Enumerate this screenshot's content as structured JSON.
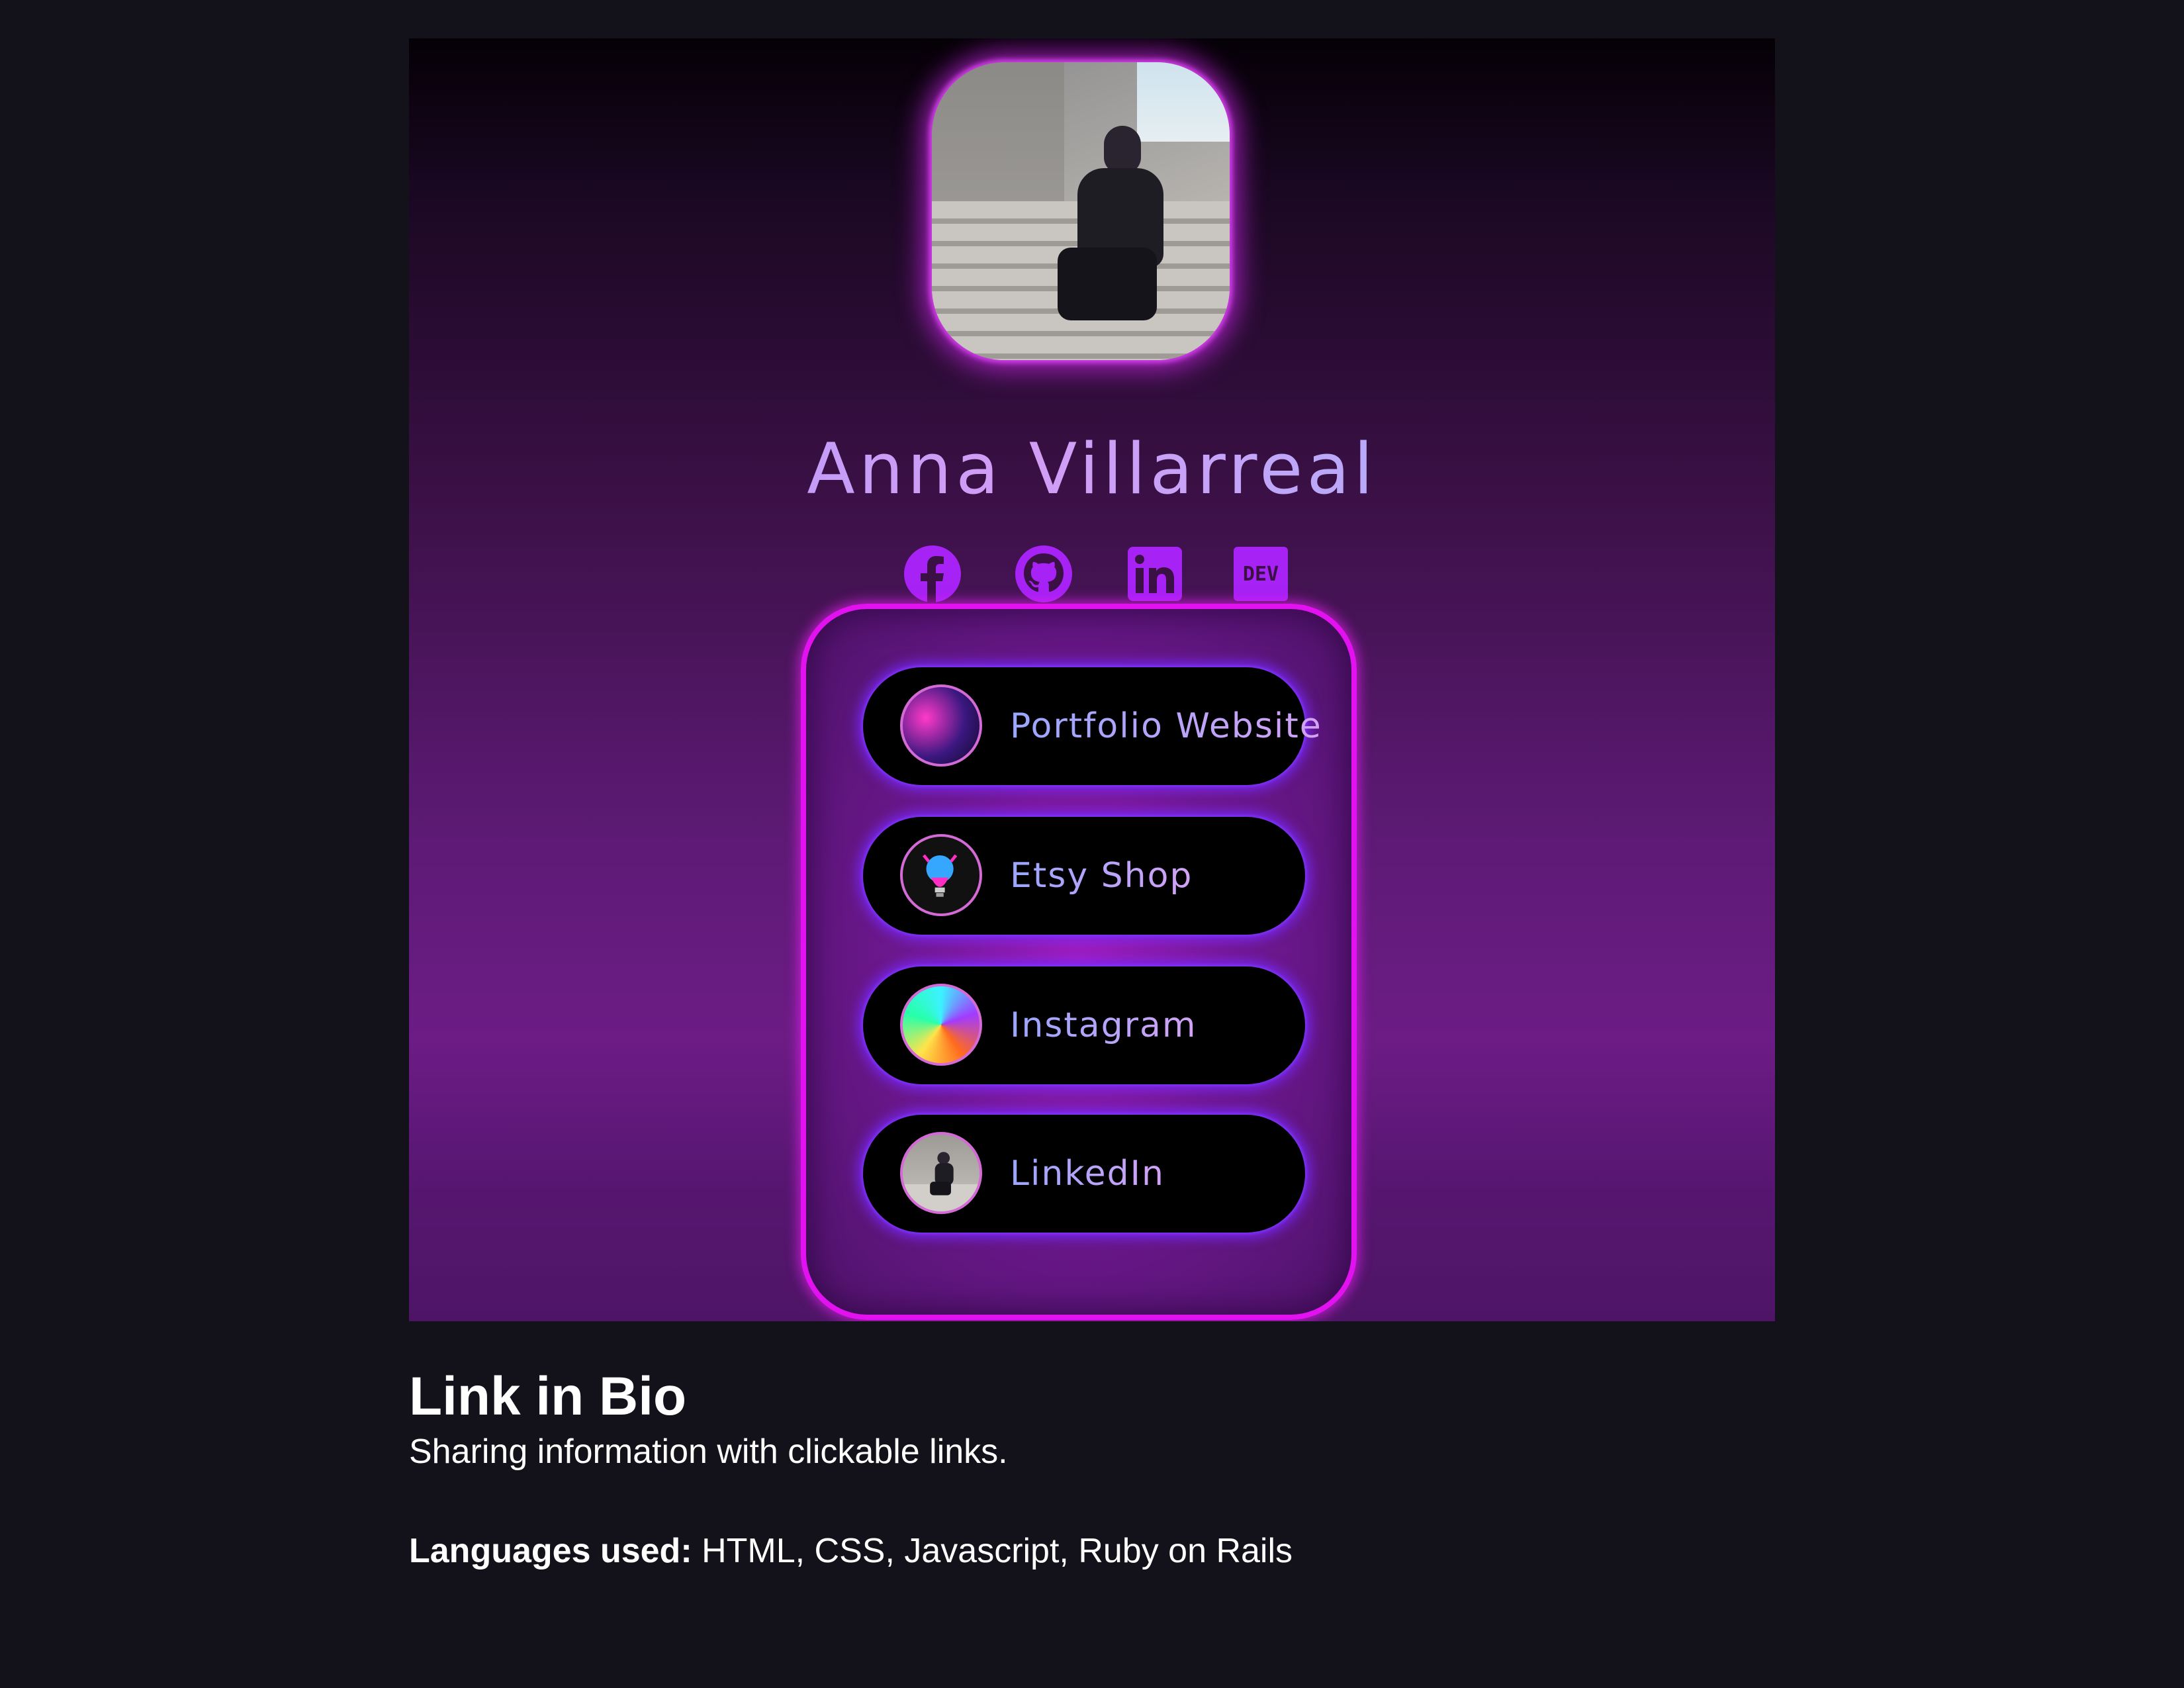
{
  "profile": {
    "name": "Anna Villarreal",
    "avatar_alt": "profile photo"
  },
  "socials": [
    {
      "name": "Facebook",
      "icon": "facebook-icon"
    },
    {
      "name": "GitHub",
      "icon": "github-icon"
    },
    {
      "name": "LinkedIn",
      "icon": "linkedin-icon"
    },
    {
      "name": "DEV",
      "icon": "dev-icon",
      "text": "DEV"
    }
  ],
  "links": [
    {
      "label": "Portfolio Website",
      "icon": "portfolio-thumbnail"
    },
    {
      "label": "Etsy Shop",
      "icon": "etsy-thumbnail"
    },
    {
      "label": "Instagram",
      "icon": "instagram-thumbnail"
    },
    {
      "label": "LinkedIn",
      "icon": "linkedin-thumbnail"
    }
  ],
  "caption": {
    "title": "Link in Bio",
    "subtitle": "Sharing information with clickable links.",
    "languages_label": "Languages used:",
    "languages_value": " HTML, CSS, Javascript, Ruby on Rails"
  },
  "colors": {
    "page_background": "#13111a",
    "accent_magenta": "#e212f0",
    "icon_purple": "#a622f5",
    "button_glow": "#7828ff"
  }
}
